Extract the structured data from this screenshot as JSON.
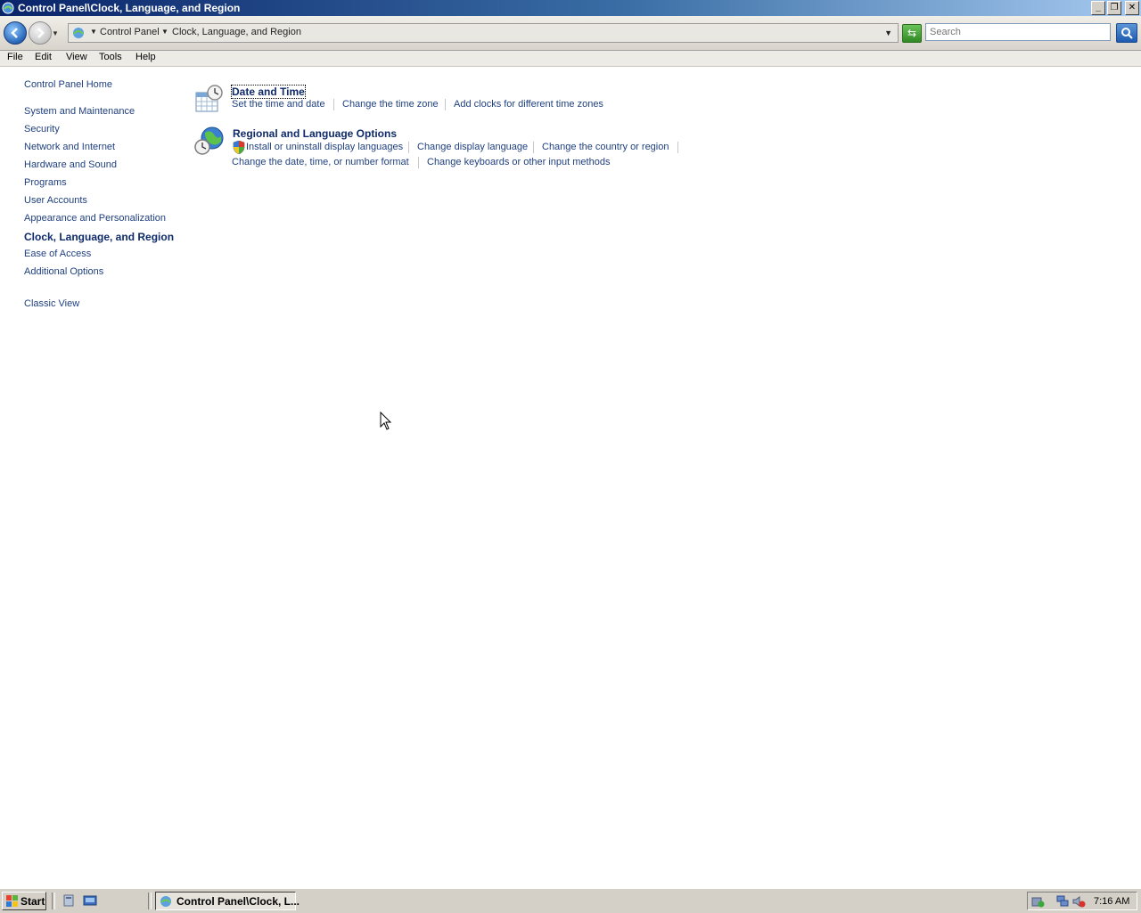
{
  "window": {
    "title": "Control Panel\\Clock, Language, and Region"
  },
  "address_bar": {
    "breadcrumbs": [
      "Control Panel",
      "Clock, Language, and Region"
    ],
    "search_placeholder": "Search"
  },
  "menu": {
    "items": [
      "File",
      "Edit",
      "View",
      "Tools",
      "Help"
    ]
  },
  "sidebar": {
    "home": "Control Panel Home",
    "items": [
      "System and Maintenance",
      "Security",
      "Network and Internet",
      "Hardware and Sound",
      "Programs",
      "User Accounts",
      "Appearance and Personalization",
      "Clock, Language, and Region",
      "Ease of Access",
      "Additional Options"
    ],
    "active_item": "Clock, Language, and Region",
    "classic_view": "Classic View"
  },
  "categories": [
    {
      "title": "Date and Time",
      "icon": "clock-calendar-icon",
      "tasks": [
        "Set the time and date",
        "Change the time zone",
        "Add clocks for different time zones"
      ]
    },
    {
      "title": "Regional and Language Options",
      "icon": "globe-clock-icon",
      "tasks": [
        "Install or uninstall display languages",
        "Change display language",
        "Change the country or region",
        "Change the date, time, or number format",
        "Change keyboards or other input methods"
      ]
    }
  ],
  "taskbar": {
    "start_label": "Start",
    "window_button": "Control Panel\\Clock, L...",
    "clock": "7:16 AM"
  },
  "colors": {
    "link": "#1f3f7f",
    "heading": "#0f2a6a",
    "titlebar_start": "#0a246a",
    "titlebar_end": "#a6caf0"
  }
}
